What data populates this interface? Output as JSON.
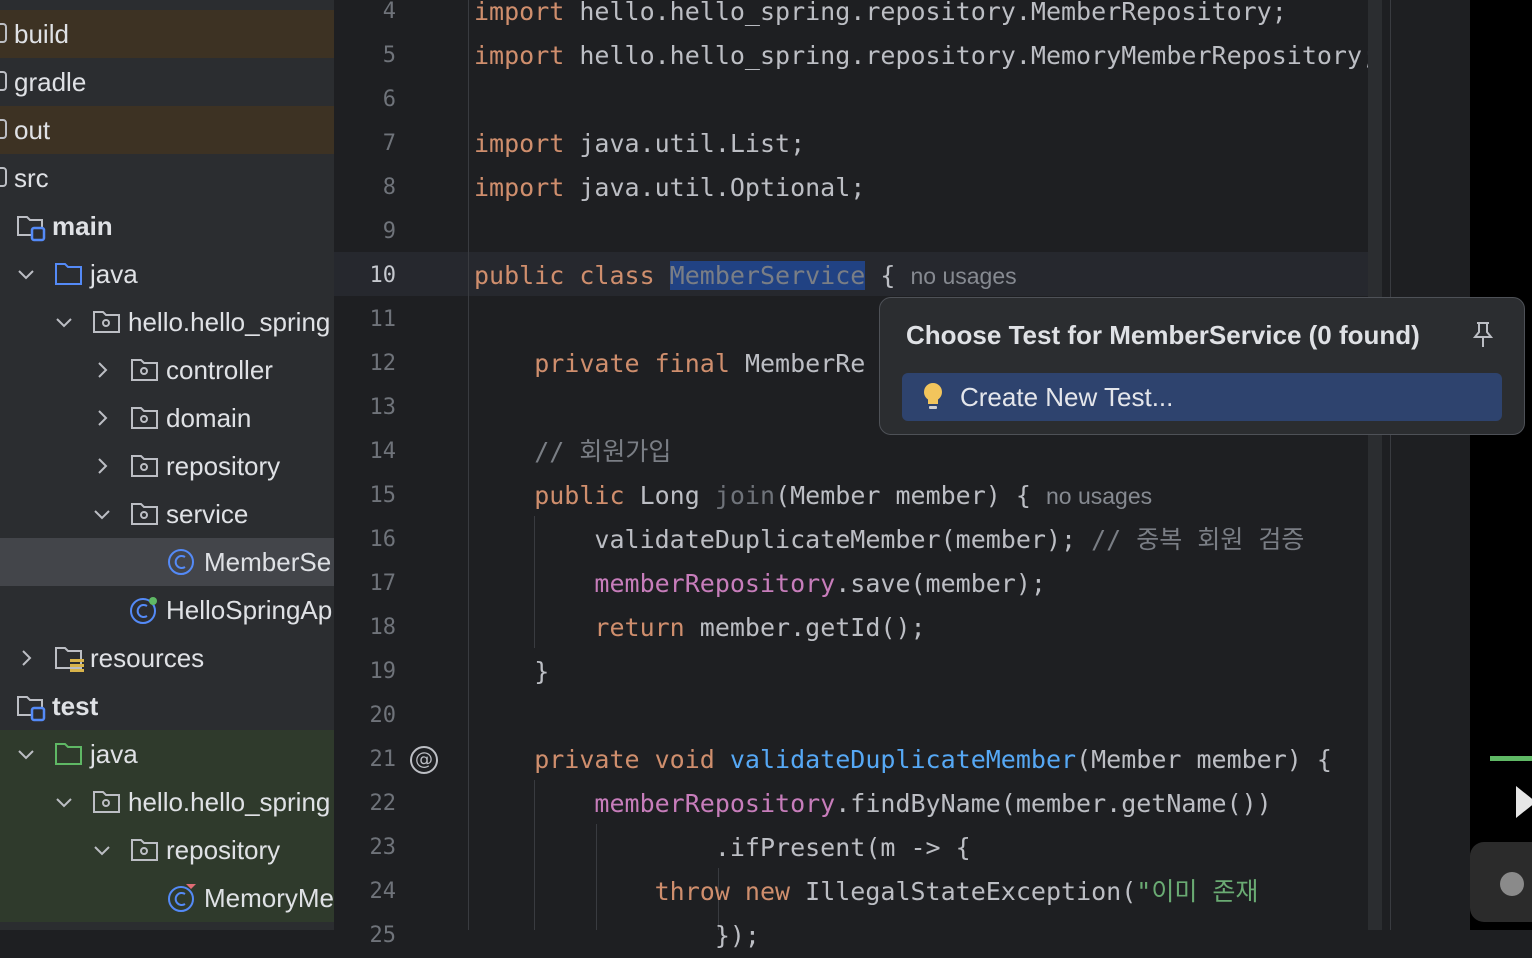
{
  "tree": {
    "items": [
      {
        "label": "build"
      },
      {
        "label": "gradle"
      },
      {
        "label": "out"
      },
      {
        "label": "src"
      },
      {
        "label": "main"
      },
      {
        "label": "java"
      },
      {
        "label": "hello.hello_spring"
      },
      {
        "label": "controller"
      },
      {
        "label": "domain"
      },
      {
        "label": "repository"
      },
      {
        "label": "service"
      },
      {
        "label": "MemberSe"
      },
      {
        "label": "HelloSpringAp"
      },
      {
        "label": "resources"
      },
      {
        "label": "test"
      },
      {
        "label": "java"
      },
      {
        "label": "hello.hello_spring"
      },
      {
        "label": "repository"
      },
      {
        "label": "MemoryMe"
      }
    ]
  },
  "editor": {
    "line_numbers": [
      "4",
      "5",
      "6",
      "7",
      "8",
      "9",
      "10",
      "11",
      "12",
      "13",
      "14",
      "15",
      "16",
      "17",
      "18",
      "19",
      "20",
      "21",
      "22",
      "23",
      "24",
      "25"
    ],
    "current_line": "10",
    "lines": {
      "l4_kw": "import",
      "l4_rest": " hello.hello_spring.repository.MemberRepository;",
      "l5_kw": "import",
      "l5_rest": " hello.hello_spring.repository.MemoryMemberRepository;",
      "l7_kw": "import",
      "l7_rest": " java.util.List;",
      "l8_kw": "import",
      "l8_rest": " java.util.Optional;",
      "l10_kw": "public class ",
      "l10_name": "MemberService",
      "l10_rest": " { ",
      "l10_hint": "no usages",
      "l12_kw": "    private final ",
      "l12_rest": "MemberRe",
      "l14_cmt": "    // 회원가입",
      "l15_kw": "    public ",
      "l15_type": "Long ",
      "l15_name": "join",
      "l15_rest": "(Member member) { ",
      "l15_hint": "no usages",
      "l16_code": "        validateDuplicateMember(member); ",
      "l16_cmt": "// 중복 회원 검증",
      "l17_fld": "        memberRepository",
      "l17_rest": ".save(member);",
      "l18_kw": "        return ",
      "l18_rest": "member.getId();",
      "l19_code": "    }",
      "l21_kw": "    private void ",
      "l21_fn": "validateDuplicateMember",
      "l21_rest": "(Member member) {",
      "l22_fld": "        memberRepository",
      "l22_rest": ".findByName(member.getName())",
      "l23_code": "                .ifPresent(m -> {",
      "l24_kw": "            throw new ",
      "l24_rest": "IllegalStateException(",
      "l24_str": "\"이미 존재",
      "l25_code": "                });"
    },
    "gutter_icon": "at-sign-icon"
  },
  "popup": {
    "title": "Choose Test for MemberService (0 found)",
    "item_label": "Create New Test...",
    "pin_icon": "pin-icon",
    "bulb_icon": "lightbulb-icon"
  },
  "colors": {
    "keyword": "#cf8e6d",
    "field": "#c77dbb",
    "function": "#56a8f5",
    "selection": "#214283",
    "popup_selected": "#2e436e"
  }
}
